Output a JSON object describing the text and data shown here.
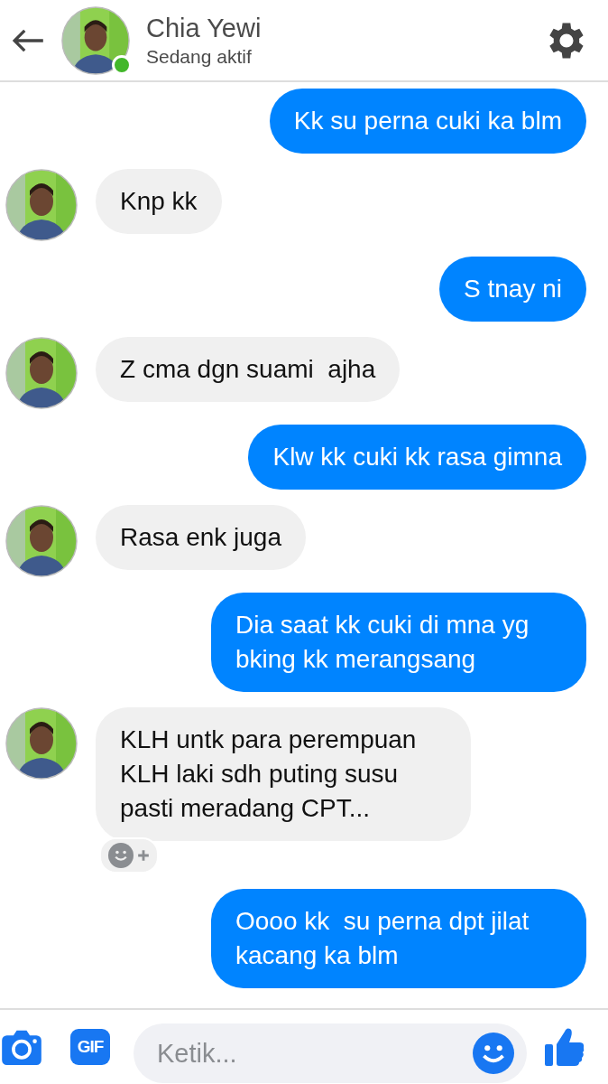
{
  "header": {
    "name": "Chia Yewi",
    "status": "Sedang aktif",
    "online": true
  },
  "messages": [
    {
      "kind": "sent",
      "text": "Kk su perna cuki ka blm"
    },
    {
      "kind": "received",
      "text": "Knp kk"
    },
    {
      "kind": "sent",
      "text": "S tnay ni"
    },
    {
      "kind": "received",
      "text": "Z cma dgn suami  ajha"
    },
    {
      "kind": "sent",
      "text": "Klw kk cuki kk rasa gimna"
    },
    {
      "kind": "received",
      "text": "Rasa enk juga"
    },
    {
      "kind": "sent",
      "text": "Dia saat kk cuki di mna yg bking kk merangsang"
    },
    {
      "kind": "received",
      "text": "KLH untk para perempuan KLH laki sdh puting susu pasti meradang CPT...",
      "reaction_bar": true
    },
    {
      "kind": "sent",
      "text": "Oooo kk  su perna dpt jilat kacang ka blm"
    }
  ],
  "composer": {
    "gif_label": "GIF",
    "placeholder": "Ketik..."
  }
}
